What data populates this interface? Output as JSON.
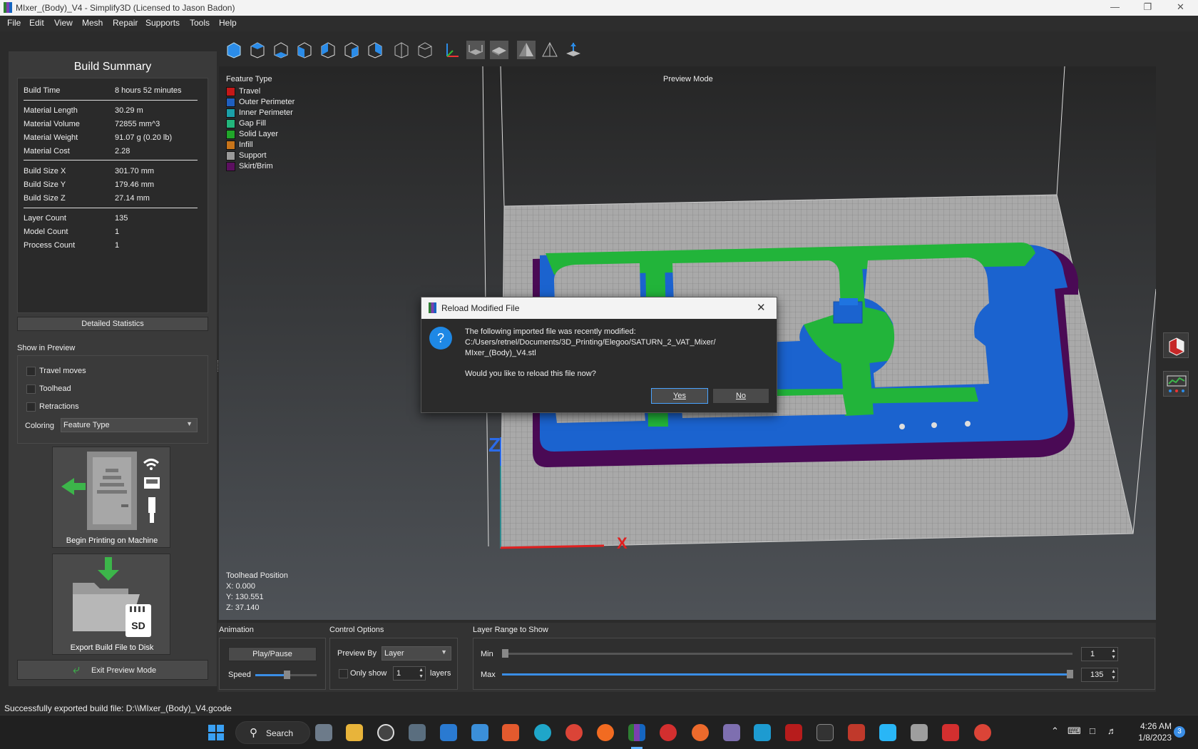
{
  "window": {
    "title": "MIxer_(Body)_V4 - Simplify3D (Licensed to Jason Badon)"
  },
  "menu": [
    "File",
    "Edit",
    "View",
    "Mesh",
    "Repair",
    "Supports",
    "Tools",
    "Help"
  ],
  "summary": {
    "title": "Build Summary",
    "rows": [
      {
        "label": "Build Time",
        "value": "8 hours 52 minutes"
      },
      {
        "label": "Material Length",
        "value": "30.29 m"
      },
      {
        "label": "Material Volume",
        "value": "72855 mm^3"
      },
      {
        "label": "Material Weight",
        "value": "91.07 g (0.20 lb)"
      },
      {
        "label": "Material Cost",
        "value": "2.28"
      },
      {
        "label": "Build Size X",
        "value": "301.70 mm"
      },
      {
        "label": "Build Size Y",
        "value": "179.46 mm"
      },
      {
        "label": "Build Size Z",
        "value": "27.14 mm"
      },
      {
        "label": "Layer Count",
        "value": "135"
      },
      {
        "label": "Model Count",
        "value": "1"
      },
      {
        "label": "Process Count",
        "value": "1"
      }
    ],
    "detailed_btn": "Detailed Statistics"
  },
  "show_preview": {
    "title": "Show in Preview",
    "travel": "Travel moves",
    "toolhead": "Toolhead",
    "retractions": "Retractions",
    "coloring_label": "Coloring",
    "coloring_value": "Feature Type"
  },
  "actions": {
    "print": "Begin Printing on Machine",
    "export": "Export Build File to Disk",
    "sd": "SD",
    "exit": "Exit Preview Mode"
  },
  "legend": {
    "title": "Feature Type",
    "items": [
      {
        "name": "Travel",
        "color": "#c41818"
      },
      {
        "name": "Outer Perimeter",
        "color": "#1f5fbf"
      },
      {
        "name": "Inner Perimeter",
        "color": "#1ba0a8"
      },
      {
        "name": "Gap Fill",
        "color": "#23b57c"
      },
      {
        "name": "Solid Layer",
        "color": "#21a62a"
      },
      {
        "name": "Infill",
        "color": "#c8741a"
      },
      {
        "name": "Support",
        "color": "#9a9a9a"
      },
      {
        "name": "Skirt/Brim",
        "color": "#5c1060"
      }
    ]
  },
  "viewport": {
    "mode": "Preview Mode",
    "axis_z": "Z",
    "axis_x": "X"
  },
  "toolhead": {
    "title": "Toolhead Position",
    "x": "X: 0.000",
    "y": "Y: 130.551",
    "z": "Z: 37.140"
  },
  "dialog": {
    "title": "Reload Modified File",
    "line1": "The following imported file was recently modified:",
    "line2": "C:/Users/retnel/Documents/3D_Printing/Elegoo/SATURN_2_VAT_Mixer/",
    "line3": "MIxer_(Body)_V4.stl",
    "question": "Would you like to reload this file now?",
    "yes": "Yes",
    "no": "No",
    "icon": "?"
  },
  "animation": {
    "title": "Animation",
    "play": "Play/Pause",
    "speed": "Speed"
  },
  "control": {
    "title": "Control Options",
    "preview_by": "Preview By",
    "preview_val": "Layer",
    "only_show": "Only show",
    "only_val": "1",
    "layers": "layers"
  },
  "layer_range": {
    "title": "Layer Range to Show",
    "min_label": "Min",
    "min_val": "1",
    "max_label": "Max",
    "max_val": "135",
    "min_fraction": 0,
    "max_fraction": 1
  },
  "status": "Successfully exported build file: D:\\\\MIxer_(Body)_V4.gcode",
  "taskbar": {
    "search": "Search",
    "time": "4:26 AM",
    "date": "1/8/2023",
    "badge": "3"
  }
}
